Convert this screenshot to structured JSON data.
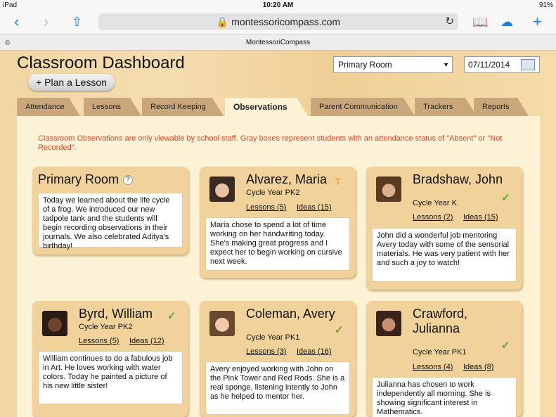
{
  "status": {
    "device": "iPad",
    "time": "10:20 AM",
    "battery": "91%"
  },
  "browser": {
    "url": "montessoricompass.com",
    "tab_title": "MontessoriCompass"
  },
  "header": {
    "title": "Classroom Dashboard",
    "plan_button": "+ Plan a Lesson",
    "room_select": "Primary Room",
    "date": "07/11/2014"
  },
  "tabs": [
    "Attendance",
    "Lessons",
    "Record Keeping",
    "Observations",
    "Parent Communication",
    "Trackers",
    "Reports"
  ],
  "notice": "Classroom Observations are only viewable by school staff. Gray boxes represent students with an attendance status of \"Absent\" or \"Not Recorded\".",
  "room": {
    "title": "Primary Room",
    "help": "?",
    "note": "Today we learned about the life cycle of a frog. We introduced our new tadpole tank and the students will begin recording observations in their journals. We also celebrated Aditya's birthday!"
  },
  "students": [
    {
      "name": "Alvarez, Maria",
      "cycle": "Cycle Year PK2",
      "lessons": "Lessons (5)",
      "ideas": "Ideas (15)",
      "note": "Maria chose to spend a lot of time working on her handwriting today. She's making great progress and I expect her to begin working on cursive next week.",
      "status_icon": "trophy-icon",
      "status_color": "#f0b040"
    },
    {
      "name": "Bradshaw, John",
      "cycle": "Cycle Year K",
      "lessons": "Lessons (2)",
      "ideas": "Ideas (15)",
      "note": "John did a wonderful job mentoring Avery today with some of the sensorial materials. He was very patient with her and such a joy to watch!",
      "status_icon": "check-icon",
      "status_color": "#5aa62e"
    },
    {
      "name": "Byrd, William",
      "cycle": "Cycle Year PK2",
      "lessons": "Lessons (5)",
      "ideas": "Ideas (12)",
      "note": "William continues to do a fabulous job in Art. He loves working with water colors. Today he painted a picture of his new little sister!",
      "status_icon": "check-icon",
      "status_color": "#5aa62e"
    },
    {
      "name": "Coleman, Avery",
      "cycle": "Cycle Year PK1",
      "lessons": "Lessons (3)",
      "ideas": "Ideas (16)",
      "note": "Avery enjoyed working with John on the Pink Tower and Red Rods. She is a real sponge, listening intently to John as he helped to mentor her.",
      "status_icon": "check-icon",
      "status_color": "#5aa62e"
    },
    {
      "name": "Crawford, Julianna",
      "cycle": "Cycle Year PK1",
      "lessons": "Lessons (4)",
      "ideas": "Ideas (8)",
      "note": "Julianna has chosen to work independently all morning.  She is showing significant interest in Mathematics.",
      "status_icon": "check-icon",
      "status_color": "#5aa62e"
    }
  ]
}
